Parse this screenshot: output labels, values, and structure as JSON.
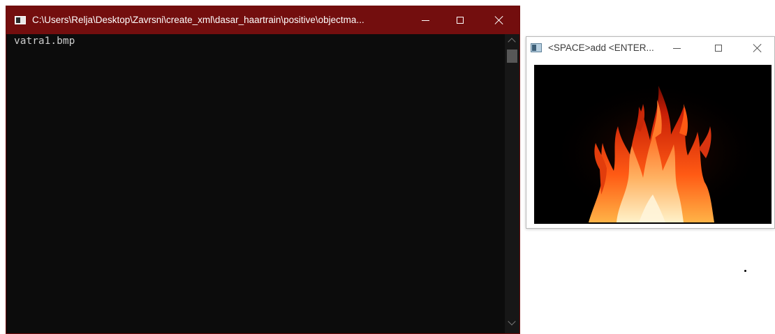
{
  "console_window": {
    "title": "C:\\Users\\Relja\\Desktop\\Zavrsni\\create_xml\\dasar_haartrain\\positive\\objectma...",
    "output_line": "vatra1.bmp",
    "accent": "#730e0e",
    "icons": [
      "console-icon",
      "minimize-icon",
      "maximize-icon",
      "close-icon",
      "scroll-up-icon",
      "scroll-down-icon"
    ]
  },
  "image_window": {
    "title": "<SPACE>add <ENTER...",
    "image": "fire-flames",
    "icons": [
      "window-icon",
      "minimize-icon",
      "maximize-icon",
      "close-icon"
    ]
  }
}
